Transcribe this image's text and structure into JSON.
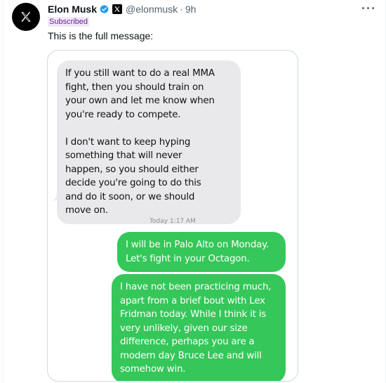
{
  "tweet": {
    "author_name": "Elon Musk",
    "handle": "@elonmusk",
    "separator": "·",
    "time": "9h",
    "subscribed_label": "Subscribed",
    "text": "This is the full message:",
    "more_label": "···"
  },
  "icons": [
    "x-logo-avatar-icon",
    "verified-badge-icon",
    "x-affiliate-badge-icon",
    "more-options-icon"
  ],
  "colors": {
    "verified_blue": "#1d9bf0",
    "imessage_green": "#35c759",
    "received_gray": "#e9e9eb",
    "subscribed_purple": "#6e1f8f"
  },
  "chat": {
    "received_message": "If you still want to do a real MMA\nfight, then you should train on\nyour own and let me know when\nyou're ready to compete.\n\nI don't want to keep hyping\nsomething that will never\nhappen, so you should either\ndecide you're going to do this\nand do it soon, or we should\nmove on.",
    "timestamp": "Today 1:17 AM",
    "sent_message_1": "I will be in Palo Alto on Monday.\nLet's fight in your Octagon.",
    "sent_message_2": "I have not been practicing much,\napart from a brief bout with Lex\nFridman today. While I think it is\nvery unlikely, given our size\ndifference, perhaps you are a\nmodern day Bruce Lee and will\nsomehow win."
  }
}
